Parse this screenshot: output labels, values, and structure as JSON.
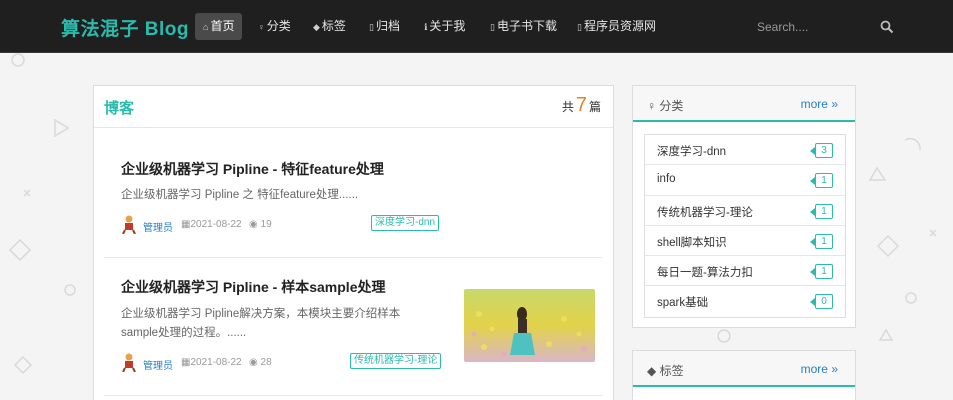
{
  "nav": {
    "brand": "算法混子 Blog",
    "items": [
      {
        "label": "首页",
        "icon": "home-icon",
        "active": true
      },
      {
        "label": "分类",
        "icon": "bulb-icon"
      },
      {
        "label": "标签",
        "icon": "tag-icon"
      },
      {
        "label": "归档",
        "icon": "archive-icon"
      },
      {
        "label": "关于我",
        "icon": "info-icon"
      },
      {
        "label": "电子书下载",
        "icon": "book-icon"
      },
      {
        "label": "程序员资源网",
        "icon": "link-icon"
      }
    ],
    "search_placeholder": "Search...."
  },
  "blog": {
    "title": "博客",
    "count_prefix": "共",
    "count": "7",
    "count_suffix": "篇",
    "posts": [
      {
        "title": "企业级机器学习 Pipline - 特征feature处理",
        "excerpt": "企业级机器学习 Pipline 之 特征feature处理......",
        "author": "管理员",
        "date": "2021-08-22",
        "views": "19",
        "tag": "深度学习-dnn"
      },
      {
        "title": "企业级机器学习 Pipline - 样本sample处理",
        "excerpt_line1": "企业级机器学习 Pipline解决方案，本模块主要介绍样本",
        "excerpt_line2": "sample处理的过程。......",
        "author": "管理员",
        "date": "2021-08-22",
        "views": "28",
        "tag": "传统机器学习-理论"
      }
    ]
  },
  "sidebar": {
    "categories": {
      "title": "分类",
      "more": "more",
      "items": [
        {
          "name": "深度学习-dnn",
          "count": "3"
        },
        {
          "name": "info",
          "count": "1"
        },
        {
          "name": "传统机器学习-理论",
          "count": "1"
        },
        {
          "name": "shell脚本知识",
          "count": "1"
        },
        {
          "name": "每日一题-算法力扣",
          "count": "1"
        },
        {
          "name": "spark基础",
          "count": "0"
        }
      ]
    },
    "tags": {
      "title": "标签",
      "more": "more"
    }
  },
  "colors": {
    "accent": "#2bbbad",
    "link": "#2a7fc1",
    "nav_bg": "#1f1f1f",
    "count": "#e8822a"
  }
}
